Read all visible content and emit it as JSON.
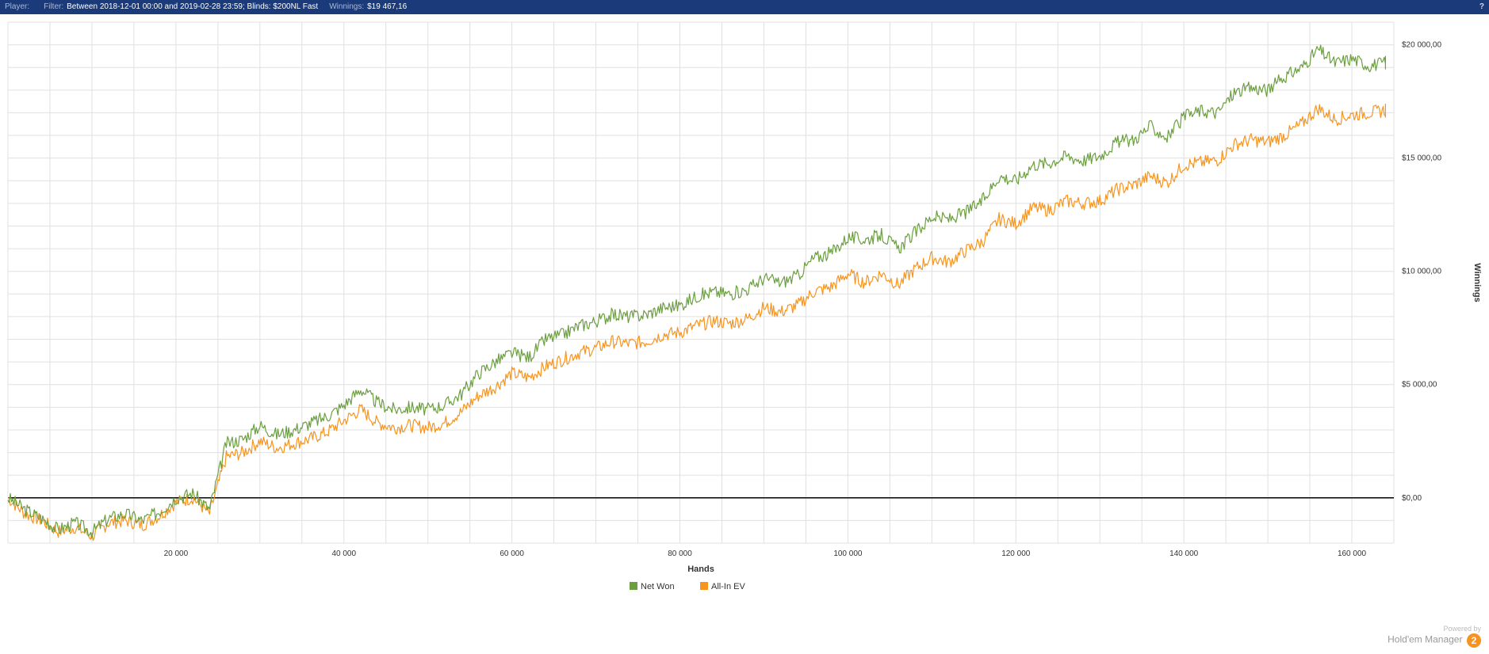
{
  "topbar": {
    "player_label": "Player:",
    "player_value": "",
    "filter_label": "Filter:",
    "filter_value": "Between 2018-12-01 00:00 and 2019-02-28 23:59; Blinds: $200NL Fast",
    "winnings_label": "Winnings:",
    "winnings_value": "$19 467,16"
  },
  "powered": {
    "line1": "Powered by",
    "line2": "Hold'em Manager",
    "badge": "2"
  },
  "chart_data": {
    "type": "line",
    "xlabel": "Hands",
    "ylabel": "Winnings",
    "xlim": [
      0,
      165000
    ],
    "ylim": [
      -2000,
      21000
    ],
    "x_ticks": [
      20000,
      40000,
      60000,
      80000,
      100000,
      120000,
      140000,
      160000
    ],
    "x_tick_labels": [
      "20 000",
      "40 000",
      "60 000",
      "80 000",
      "100 000",
      "120 000",
      "140 000",
      "160 000"
    ],
    "y_ticks": [
      0,
      5000,
      10000,
      15000,
      20000
    ],
    "y_tick_labels": [
      "$0,00",
      "$5 000,00",
      "$10 000,00",
      "$15 000,00",
      "$20 000,00"
    ],
    "x": [
      0,
      2000,
      4000,
      6000,
      8000,
      10000,
      12000,
      14000,
      16000,
      18000,
      20000,
      22000,
      24000,
      26000,
      28000,
      30000,
      32000,
      34000,
      36000,
      38000,
      40000,
      42000,
      44000,
      46000,
      48000,
      50000,
      52000,
      54000,
      56000,
      58000,
      60000,
      62000,
      64000,
      66000,
      68000,
      70000,
      72000,
      74000,
      76000,
      78000,
      80000,
      82000,
      84000,
      86000,
      88000,
      90000,
      92000,
      94000,
      96000,
      98000,
      100000,
      102000,
      104000,
      106000,
      108000,
      110000,
      112000,
      114000,
      116000,
      118000,
      120000,
      122000,
      124000,
      126000,
      128000,
      130000,
      132000,
      134000,
      136000,
      138000,
      140000,
      142000,
      144000,
      146000,
      148000,
      150000,
      152000,
      154000,
      156000,
      158000,
      160000,
      162000,
      164000
    ],
    "legend": {
      "position": "bottom",
      "items": [
        "Net Won",
        "All-In EV"
      ]
    },
    "colors": {
      "net_won": "#6b9f3f",
      "all_in_ev": "#f7941e"
    },
    "series": [
      {
        "name": "Net Won",
        "color": "#6b9f3f",
        "values": [
          0,
          -500,
          -900,
          -1400,
          -1100,
          -1500,
          -900,
          -700,
          -1000,
          -600,
          0,
          200,
          -500,
          2400,
          2600,
          3200,
          2800,
          3000,
          3300,
          3600,
          4100,
          4800,
          4200,
          3900,
          4000,
          3900,
          4100,
          4600,
          5500,
          6000,
          6400,
          6200,
          7000,
          7200,
          7600,
          7800,
          8100,
          8000,
          8100,
          8400,
          8500,
          8900,
          9100,
          9000,
          9200,
          9700,
          9500,
          9800,
          10600,
          10800,
          11500,
          11400,
          11600,
          11000,
          11700,
          12400,
          12300,
          12600,
          13100,
          14200,
          14000,
          14700,
          14800,
          15100,
          14900,
          15100,
          15700,
          15800,
          16400,
          15900,
          16800,
          17100,
          17000,
          17900,
          18100,
          18000,
          18600,
          19000,
          19800,
          19200,
          19400,
          19100,
          19200
        ]
      },
      {
        "name": "All-In EV",
        "color": "#f7941e",
        "values": [
          0,
          -700,
          -1000,
          -1500,
          -1300,
          -1700,
          -1100,
          -1000,
          -1200,
          -800,
          -200,
          0,
          -700,
          1800,
          2000,
          2500,
          2200,
          2400,
          2600,
          2900,
          3400,
          3900,
          3300,
          3100,
          3200,
          3100,
          3300,
          3800,
          4500,
          4900,
          5500,
          5300,
          5800,
          6100,
          6400,
          6600,
          6900,
          6800,
          6900,
          7200,
          7300,
          7600,
          7800,
          7700,
          7900,
          8400,
          8200,
          8500,
          9100,
          9300,
          9900,
          9500,
          9900,
          9400,
          10100,
          10600,
          10400,
          10900,
          11300,
          12300,
          12100,
          12800,
          12700,
          13100,
          13000,
          13100,
          13600,
          13800,
          14200,
          13900,
          14700,
          14800,
          14900,
          15600,
          15800,
          15700,
          16000,
          16500,
          17200,
          16700,
          16900,
          17000,
          17100
        ]
      }
    ]
  }
}
